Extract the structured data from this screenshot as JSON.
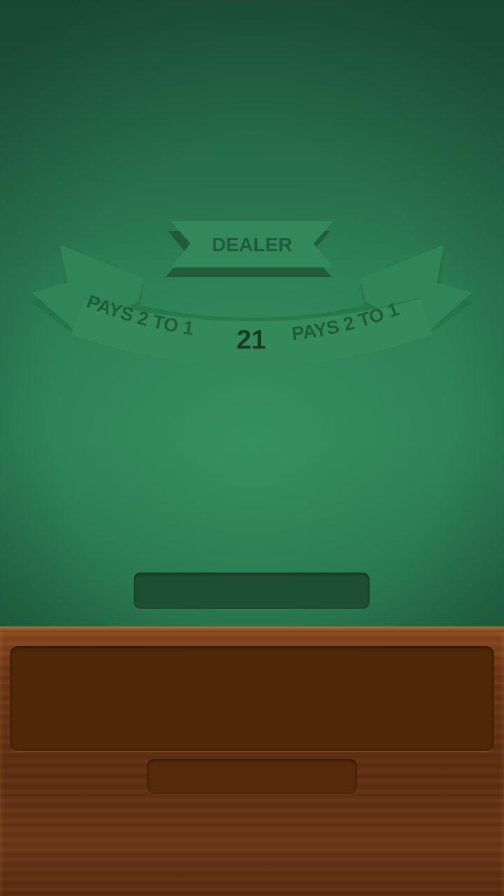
{
  "table": {
    "dealer_label": "DEALER",
    "left_payout": "PAYS 2 TO 1",
    "right_payout": "PAYS 2 TO 1",
    "center_value": "21"
  },
  "colors": {
    "felt": "#2a7a52",
    "ribbon": "#2e8355",
    "ribbon_text": "#1e5a39",
    "center_text": "#163b26",
    "wood": "#6a3414",
    "panel": "#512808",
    "slot_green": "#1f4f33"
  }
}
